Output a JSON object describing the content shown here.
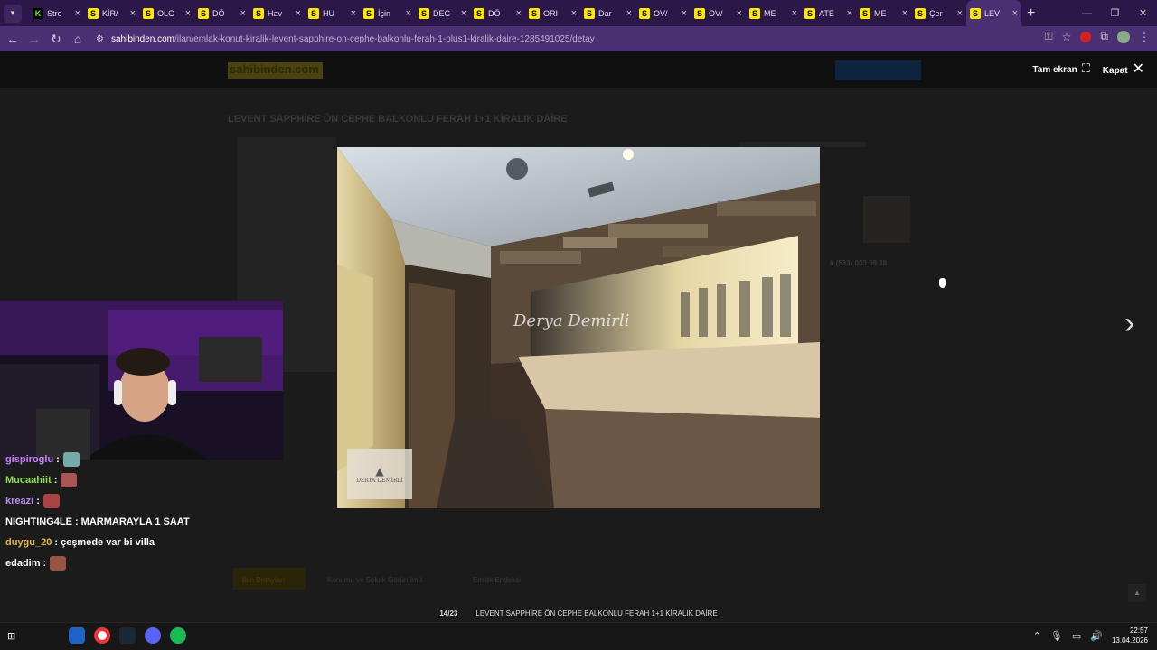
{
  "browser": {
    "tabs": [
      {
        "label": "Stre",
        "favicon": "K",
        "kind": "k"
      },
      {
        "label": "KİR/",
        "favicon": "S"
      },
      {
        "label": "OLG",
        "favicon": "S"
      },
      {
        "label": "DÖ",
        "favicon": "S"
      },
      {
        "label": "Hav",
        "favicon": "S"
      },
      {
        "label": "HU",
        "favicon": "S"
      },
      {
        "label": "İçin",
        "favicon": "S"
      },
      {
        "label": "DEC",
        "favicon": "S"
      },
      {
        "label": "DÖ",
        "favicon": "S"
      },
      {
        "label": "ORI",
        "favicon": "S"
      },
      {
        "label": "Dar",
        "favicon": "S"
      },
      {
        "label": "OV/",
        "favicon": "S"
      },
      {
        "label": "OV/",
        "favicon": "S"
      },
      {
        "label": "ME",
        "favicon": "S"
      },
      {
        "label": "ATE",
        "favicon": "S"
      },
      {
        "label": "ME",
        "favicon": "S"
      },
      {
        "label": "Çer",
        "favicon": "S"
      },
      {
        "label": "LEV",
        "favicon": "S",
        "active": true
      }
    ],
    "url_domain": "sahibinden.com",
    "url_path": "/ilan/emlak-konut-kiralik-levent-sapphire-on-cephe-balkonlu-ferah-1-plus1-kiralik-daire-1285491025/detay"
  },
  "page": {
    "logo": "sahibinden.com",
    "listing_title": "LEVENT SAPPHİRE ÖN CEPHE BALKONLU FERAH 1+1 KİRALIK DAİRE",
    "phone": "0 (533) 033 59 38",
    "tabs": [
      "İlan Detayları",
      "Konumu ve Sokak Görünümü",
      "Emlak Endeksi"
    ]
  },
  "gallery": {
    "fullscreen_label": "Tam ekran",
    "close_label": "Kapat",
    "counter": "14/23",
    "caption": "LEVENT SAPPHİRE ÖN CEPHE BALKONLU FERAH 1+1 KİRALIK DAİRE",
    "watermark_text": "Derya Demirli",
    "watermark_box": "DERYA DEMİRLİ"
  },
  "chat": [
    {
      "user": "gispiroglu",
      "text": ":",
      "color": "#c77dff",
      "emote": "#7aa"
    },
    {
      "user": "Mucaahiit",
      "text": ":",
      "color": "#8be04e",
      "emote": "#a55"
    },
    {
      "user": "kreazi",
      "text": ":",
      "color": "#b98cf0",
      "emote": "#a44"
    },
    {
      "user": "NIGHTING4LE",
      "text": ": MARMARAYLA 1 SAAT",
      "color": "#ffffff"
    },
    {
      "user": "duygu_20",
      "text": ": çeşmede var bi villa",
      "color": "#e4b84e"
    },
    {
      "user": "edadim",
      "text": ":",
      "color": "#ffffff",
      "emote": "#954"
    }
  ],
  "taskbar": {
    "time": "22:57",
    "date": "13.04.2026"
  }
}
